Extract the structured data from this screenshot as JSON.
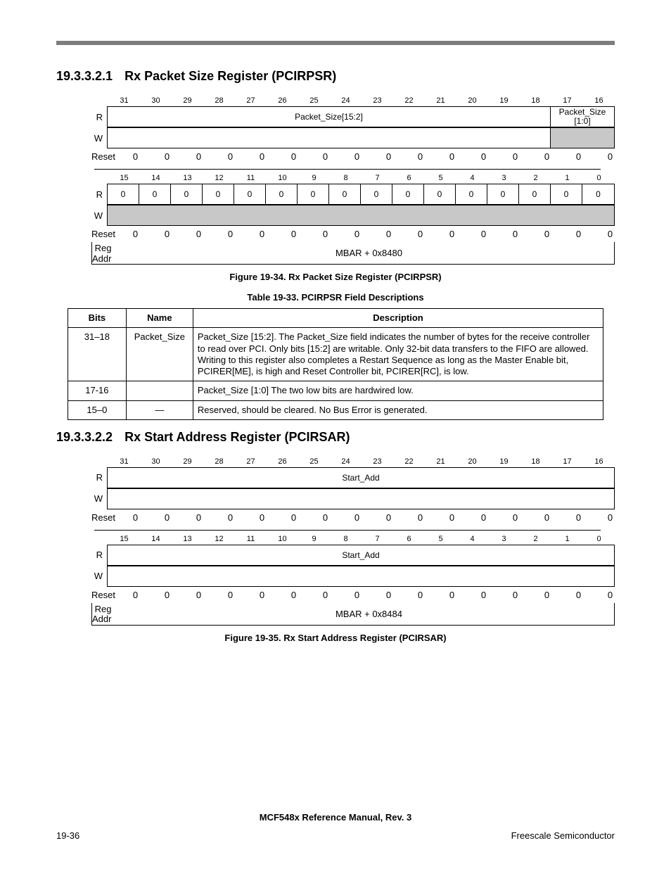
{
  "sections": {
    "s1": {
      "num": "19.3.3.2.1",
      "title": "Rx Packet Size Register (PCIRPSR)"
    },
    "s2": {
      "num": "19.3.3.2.2",
      "title": "Rx Start Address Register (PCIRSAR)"
    }
  },
  "fig1": {
    "bits_high": [
      "31",
      "30",
      "29",
      "28",
      "27",
      "26",
      "25",
      "24",
      "23",
      "22",
      "21",
      "20",
      "19",
      "18",
      "17",
      "16"
    ],
    "field_high_1": "Packet_Size[15:2]",
    "field_high_2": "Packet_Size [1:0]",
    "reset_high": [
      "0",
      "0",
      "0",
      "0",
      "0",
      "0",
      "0",
      "0",
      "0",
      "0",
      "0",
      "0",
      "0",
      "0",
      "0",
      "0"
    ],
    "bits_low": [
      "15",
      "14",
      "13",
      "12",
      "11",
      "10",
      "9",
      "8",
      "7",
      "6",
      "5",
      "4",
      "3",
      "2",
      "1",
      "0"
    ],
    "val_low": [
      "0",
      "0",
      "0",
      "0",
      "0",
      "0",
      "0",
      "0",
      "0",
      "0",
      "0",
      "0",
      "0",
      "0",
      "0",
      "0"
    ],
    "reset_low": [
      "0",
      "0",
      "0",
      "0",
      "0",
      "0",
      "0",
      "0",
      "0",
      "0",
      "0",
      "0",
      "0",
      "0",
      "0",
      "0"
    ],
    "addr": "MBAR + 0x8480",
    "caption": "Figure 19-34. Rx Packet Size Register (PCIRPSR)"
  },
  "table1": {
    "caption": "Table 19-33. PCIRPSR Field Descriptions",
    "head": {
      "bits": "Bits",
      "name": "Name",
      "desc": "Description"
    },
    "rows": [
      {
        "bits": "31–18",
        "name": "Packet_Size",
        "desc": "Packet_Size [15:2]. The Packet_Size field indicates the number of bytes for the receive controller to read over PCI. Only bits [15:2] are writable. Only 32-bit data transfers to the FIFO are allowed. Writing to this register also completes a Restart Sequence as long as the Master Enable bit, PCIRER[ME], is high and Reset Controller bit, PCIRER[RC], is low."
      },
      {
        "bits": "17-16",
        "name": "",
        "desc": "Packet_Size [1:0] The two low bits are hardwired low."
      },
      {
        "bits": "15–0",
        "name": "—",
        "desc": "Reserved, should be cleared. No Bus Error is generated."
      }
    ]
  },
  "fig2": {
    "bits_high": [
      "31",
      "30",
      "29",
      "28",
      "27",
      "26",
      "25",
      "24",
      "23",
      "22",
      "21",
      "20",
      "19",
      "18",
      "17",
      "16"
    ],
    "field_high": "Start_Add",
    "reset_high": [
      "0",
      "0",
      "0",
      "0",
      "0",
      "0",
      "0",
      "0",
      "0",
      "0",
      "0",
      "0",
      "0",
      "0",
      "0",
      "0"
    ],
    "bits_low": [
      "15",
      "14",
      "13",
      "12",
      "11",
      "10",
      "9",
      "8",
      "7",
      "6",
      "5",
      "4",
      "3",
      "2",
      "1",
      "0"
    ],
    "field_low": "Start_Add",
    "reset_low": [
      "0",
      "0",
      "0",
      "0",
      "0",
      "0",
      "0",
      "0",
      "0",
      "0",
      "0",
      "0",
      "0",
      "0",
      "0",
      "0"
    ],
    "addr": "MBAR + 0x8484",
    "caption": "Figure 19-35. Rx Start Address Register (PCIRSAR)"
  },
  "labels": {
    "R": "R",
    "W": "W",
    "Reset": "Reset",
    "Reg": "Reg",
    "Addr": "Addr"
  },
  "footer": {
    "doc": "MCF548x Reference Manual, Rev. 3",
    "pageno": "19-36",
    "company": "Freescale Semiconductor"
  }
}
